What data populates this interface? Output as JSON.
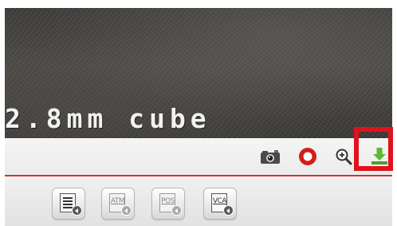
{
  "video": {
    "overlay_text": "2.8mm cube"
  },
  "control_bar": {
    "icons": [
      "camera-icon",
      "record-icon",
      "zoom-in-icon",
      "download-icon"
    ],
    "highlight_color": "#e0121c",
    "accent_line_color": "#d23030"
  },
  "toolbar": {
    "buttons": [
      {
        "label": "",
        "icon": "list-document-icon"
      },
      {
        "label": "ATM",
        "icon": "atm-document-icon"
      },
      {
        "label": "POS",
        "icon": "pos-document-icon"
      },
      {
        "label": "VCA",
        "icon": "vca-document-icon"
      }
    ]
  }
}
